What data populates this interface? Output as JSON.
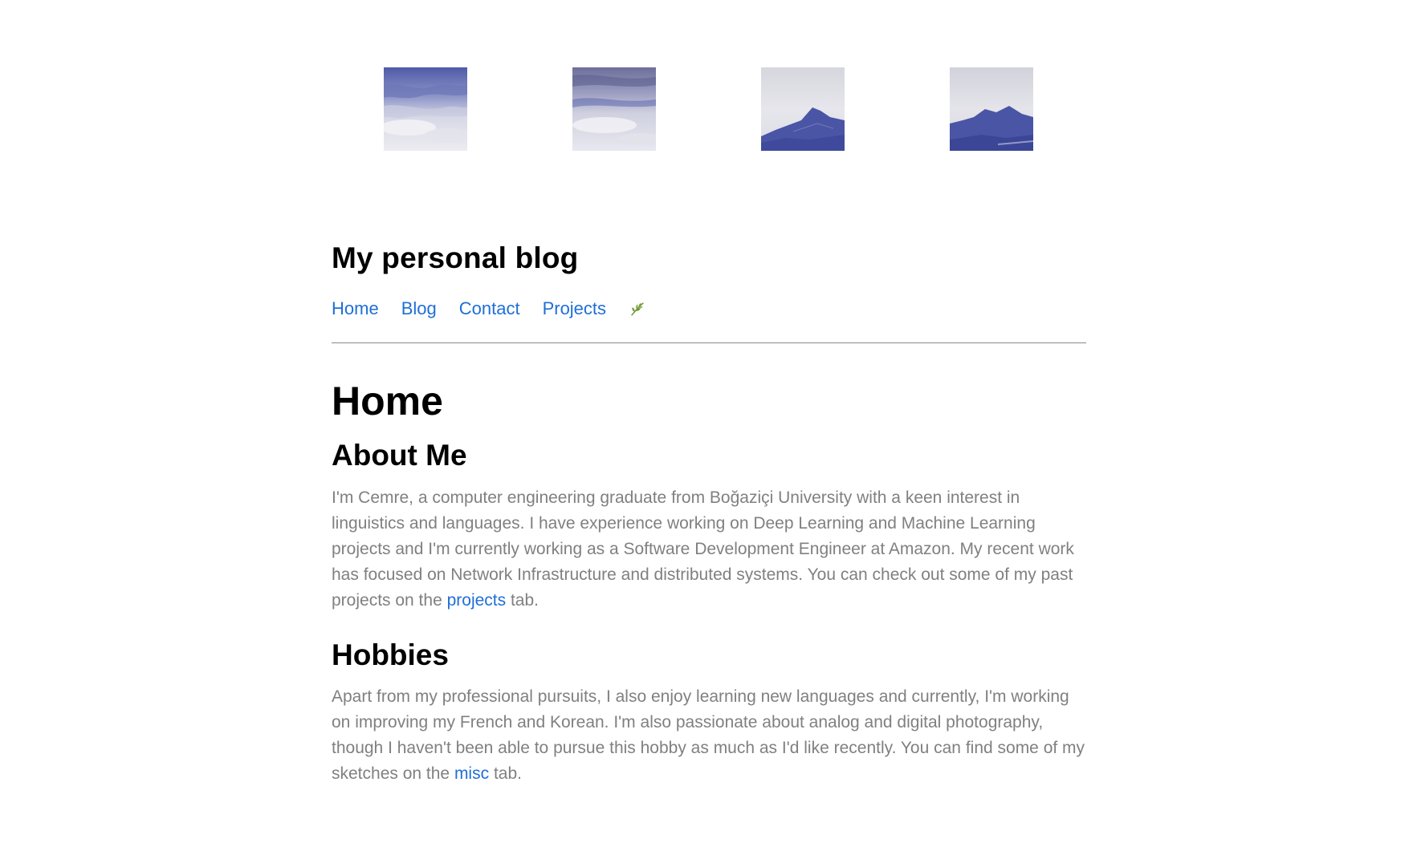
{
  "header_images": [
    {
      "name": "sky-clouds-1"
    },
    {
      "name": "sky-clouds-2"
    },
    {
      "name": "blue-mountains-1"
    },
    {
      "name": "blue-mountains-2"
    }
  ],
  "site": {
    "title": "My personal blog"
  },
  "nav": {
    "items": [
      {
        "label": "Home"
      },
      {
        "label": "Blog"
      },
      {
        "label": "Contact"
      },
      {
        "label": "Projects"
      }
    ],
    "leaf_icon": "leaf-icon"
  },
  "main": {
    "page_title": "Home",
    "about": {
      "heading": "About Me",
      "text_before": "I'm Cemre, a computer engineering graduate from Boğaziçi University with a keen interest in linguistics and languages. I have experience working on Deep Learning and Machine Learning projects and I'm currently working as a Software Development Engineer at Amazon. My recent work has focused on Network Infrastructure and distributed systems. You can check out some of my past projects on the ",
      "link": "projects",
      "text_after": " tab."
    },
    "hobbies": {
      "heading": "Hobbies",
      "text_before": "Apart from my professional pursuits, I also enjoy learning new languages and currently, I'm working on improving my French and Korean. I'm also passionate about analog and digital photography, though I haven't been able to pursue this hobby as much as I'd like recently. You can find some of my sketches on the ",
      "link": "misc",
      "text_after": " tab."
    }
  },
  "colors": {
    "link": "#1f6fd6",
    "body_text": "#808080",
    "heading": "#000000",
    "rule": "#8a8a8a"
  }
}
